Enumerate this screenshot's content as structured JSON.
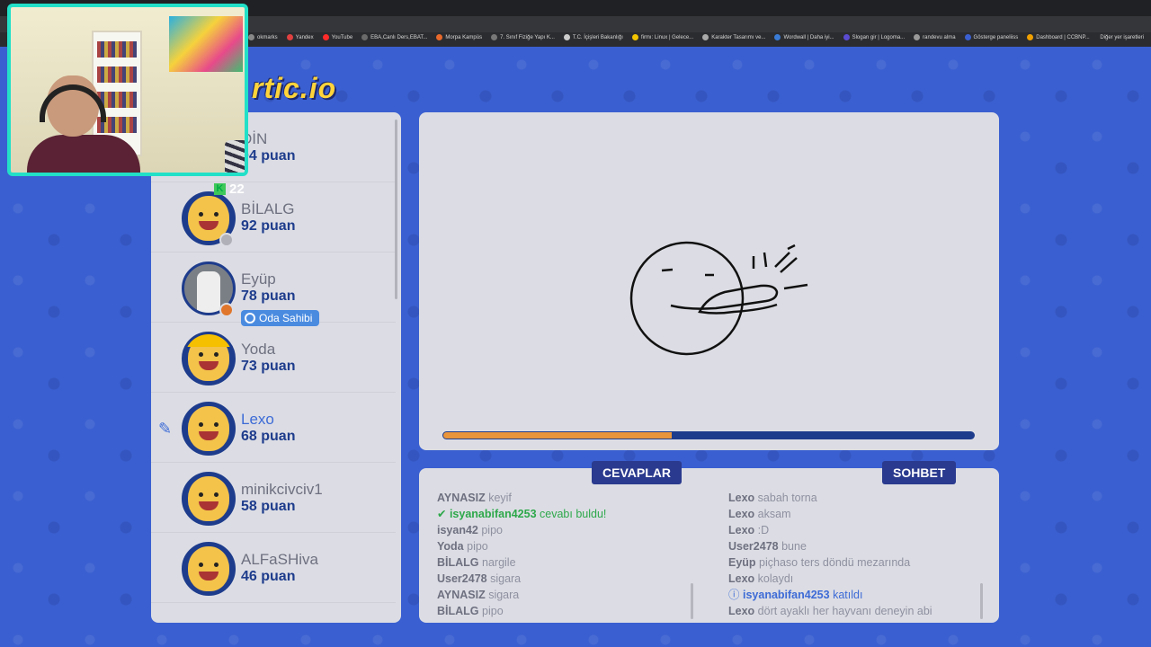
{
  "browser": {
    "bookmarks": [
      {
        "label": "okmarks",
        "color": "#888888"
      },
      {
        "label": "Yandex",
        "color": "#e04040"
      },
      {
        "label": "YouTube",
        "color": "#ff2a2a"
      },
      {
        "label": "EBA,Canlı Ders,EBAT...",
        "color": "#6a6a6a"
      },
      {
        "label": "Morpa Kampüs",
        "color": "#e8692b"
      },
      {
        "label": "7. Sınıf Fiziğe Yapı K...",
        "color": "#777777"
      },
      {
        "label": "T.C. İçişleri Bakanlığı",
        "color": "#cccccc"
      },
      {
        "label": "firmı: Linux | Gelece...",
        "color": "#f2c400"
      },
      {
        "label": "Karakter Tasarımı ve...",
        "color": "#aaaaaa"
      },
      {
        "label": "Wordwall | Daha iyi...",
        "color": "#3a7bd5"
      },
      {
        "label": "Slogan gir | Logoma...",
        "color": "#5a4bd1"
      },
      {
        "label": "randevu alma",
        "color": "#999999"
      },
      {
        "label": "Gösterge paneliiss",
        "color": "#3a5fd0"
      },
      {
        "label": "Dashboard | CCBNP...",
        "color": "#f0a000"
      }
    ],
    "other_bookmarks": "Diğer yer işaretleri"
  },
  "game": {
    "logo": "rtic.io",
    "counter": {
      "icon": "k-icon",
      "value": "22"
    },
    "players": [
      {
        "name": "DİN",
        "score": "04 puan",
        "avatar": "smiley",
        "dot": null
      },
      {
        "name": "BİLALG",
        "score": "92 puan",
        "avatar": "smiley",
        "dot": "#b0b0b8"
      },
      {
        "name": "Eyüp",
        "score": "78 puan",
        "avatar": "photo",
        "dot": "#e0762b",
        "badge": "Oda Sahibi"
      },
      {
        "name": "Yoda",
        "score": "73 puan",
        "avatar": "hat",
        "dot": null
      },
      {
        "name": "Lexo",
        "score": "68 puan",
        "avatar": "smiley",
        "dot": null,
        "drawing": true
      },
      {
        "name": "minikcivciv1",
        "score": "58 puan",
        "avatar": "smiley",
        "dot": null
      },
      {
        "name": "ALFaSHiva",
        "score": "46 puan",
        "avatar": "smiley",
        "dot": null
      }
    ],
    "round_progress": 0.43,
    "answers_tab": "CEVAPLAR",
    "chat_tab": "SOHBET",
    "answers": [
      {
        "user": "AYNASIZ",
        "text": "keyif",
        "type": "normal"
      },
      {
        "user": "isyanabifan4253",
        "text": "cevabı buldu!",
        "type": "correct"
      },
      {
        "user": "isyan42",
        "text": "pipo",
        "type": "normal"
      },
      {
        "user": "Yoda",
        "text": "pipo",
        "type": "normal"
      },
      {
        "user": "BİLALG",
        "text": "nargile",
        "type": "normal"
      },
      {
        "user": "User2478",
        "text": "sigara",
        "type": "normal"
      },
      {
        "user": "AYNASIZ",
        "text": "sigara",
        "type": "normal"
      },
      {
        "user": "BİLALG",
        "text": "pipo",
        "type": "normal"
      }
    ],
    "chat": [
      {
        "user": "Lexo",
        "text": "sabah torna",
        "type": "normal"
      },
      {
        "user": "Lexo",
        "text": "aksam",
        "type": "normal"
      },
      {
        "user": "Lexo",
        "text": ":D",
        "type": "normal"
      },
      {
        "user": "User2478",
        "text": "bune",
        "type": "normal"
      },
      {
        "user": "Eyüp",
        "text": "piçhaso ters döndü mezarında",
        "type": "normal"
      },
      {
        "user": "Lexo",
        "text": "kolaydı",
        "type": "normal"
      },
      {
        "user": "isyanabifan4253",
        "text": "katıldı",
        "type": "join"
      },
      {
        "user": "Lexo",
        "text": "dört ayaklı her hayvanı deneyin abi",
        "type": "normal"
      }
    ]
  }
}
